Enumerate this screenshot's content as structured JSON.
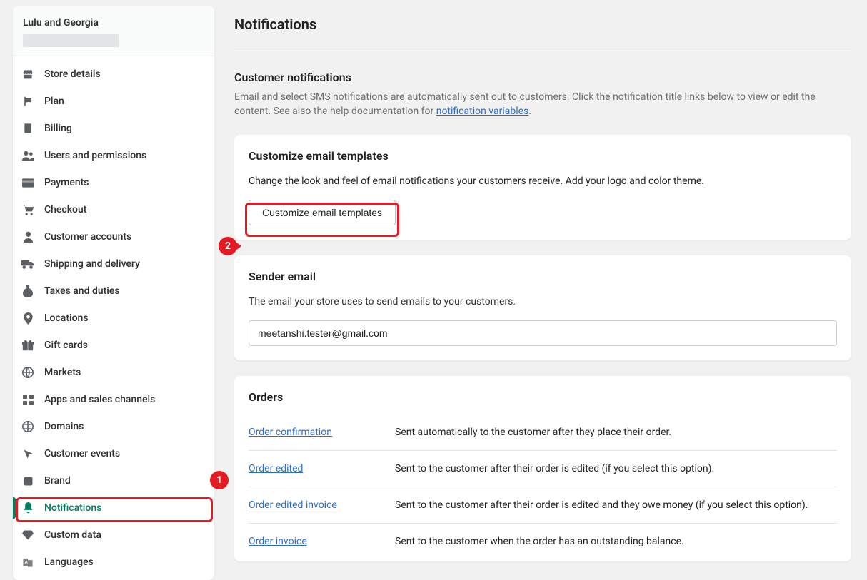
{
  "store": {
    "name": "Lulu and Georgia"
  },
  "sidebar": {
    "items": [
      {
        "label": "Store details"
      },
      {
        "label": "Plan"
      },
      {
        "label": "Billing"
      },
      {
        "label": "Users and permissions"
      },
      {
        "label": "Payments"
      },
      {
        "label": "Checkout"
      },
      {
        "label": "Customer accounts"
      },
      {
        "label": "Shipping and delivery"
      },
      {
        "label": "Taxes and duties"
      },
      {
        "label": "Locations"
      },
      {
        "label": "Gift cards"
      },
      {
        "label": "Markets"
      },
      {
        "label": "Apps and sales channels"
      },
      {
        "label": "Domains"
      },
      {
        "label": "Customer events"
      },
      {
        "label": "Brand"
      },
      {
        "label": "Notifications"
      },
      {
        "label": "Custom data"
      },
      {
        "label": "Languages"
      }
    ]
  },
  "page": {
    "title": "Notifications",
    "customer_notifications": {
      "title": "Customer notifications",
      "desc_prefix": "Email and select SMS notifications are automatically sent out to customers. Click the notification title links below to view or edit the content. See also the help documentation for ",
      "link_text": "notification variables",
      "desc_suffix": "."
    },
    "customize": {
      "title": "Customize email templates",
      "desc": "Change the look and feel of email notifications your customers receive. Add your logo and color theme.",
      "button": "Customize email templates"
    },
    "sender": {
      "title": "Sender email",
      "desc": "The email your store uses to send emails to your customers.",
      "value": "meetanshi.tester@gmail.com"
    },
    "orders": {
      "title": "Orders",
      "rows": [
        {
          "link": "Order confirmation",
          "desc": "Sent automatically to the customer after they place their order."
        },
        {
          "link": "Order edited",
          "desc": "Sent to the customer after their order is edited (if you select this option)."
        },
        {
          "link": "Order edited invoice",
          "desc": "Sent to the customer after their order is edited and they owe money (if you select this option)."
        },
        {
          "link": "Order invoice",
          "desc": "Sent to the customer when the order has an outstanding balance."
        }
      ]
    }
  },
  "annotations": {
    "one": "1",
    "two": "2"
  }
}
